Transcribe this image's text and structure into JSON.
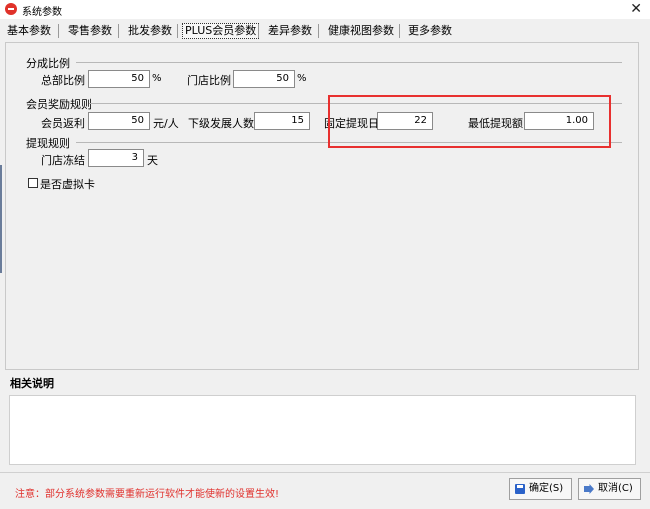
{
  "window": {
    "title": "系统参数",
    "close_glyph": "✕"
  },
  "tabs": [
    {
      "label": "基本参数"
    },
    {
      "label": "零售参数"
    },
    {
      "label": "批发参数"
    },
    {
      "label": "PLUS会员参数"
    },
    {
      "label": "差异参数"
    },
    {
      "label": "健康视图参数"
    },
    {
      "label": "更多参数"
    }
  ],
  "active_tab": "PLUS会员参数",
  "groups": {
    "split": {
      "title": "分成比例",
      "hq_ratio": {
        "label": "总部比例",
        "value": "50",
        "unit": "%"
      },
      "store_ratio": {
        "label": "门店比例",
        "value": "50",
        "unit": "%"
      }
    },
    "reward": {
      "title": "会员奖励规则",
      "member_rebate": {
        "label": "会员返利",
        "value": "50",
        "unit": "元/人"
      },
      "sub_members": {
        "label": "下级发展人数",
        "value": "15"
      },
      "fixed_day": {
        "label": "固定提现日",
        "value": "22"
      },
      "min_amount": {
        "label": "最低提现额",
        "value": "1.00"
      }
    },
    "withdraw": {
      "title": "提现规则",
      "freeze": {
        "label": "门店冻结",
        "value": "3",
        "unit": "天"
      }
    },
    "virtual_card": {
      "label": "是否虚拟卡",
      "checked": false
    }
  },
  "description": {
    "title": "相关说明",
    "text": ""
  },
  "footer": {
    "notice": "注意：部分系统参数需要重新运行软件才能使新的设置生效!",
    "ok_label": "确定(S)",
    "cancel_label": "取消(C)"
  },
  "colors": {
    "highlight": "#e8302f",
    "notice": "#e0302c",
    "app_icon": "#e0322a"
  },
  "icons": {
    "app": "app-logo-icon",
    "ok": "save-icon",
    "cancel": "exit-icon"
  }
}
